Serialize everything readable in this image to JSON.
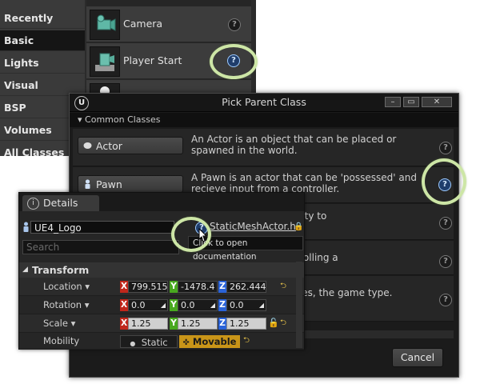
{
  "place_actors": {
    "categories": [
      {
        "label": "Recently Placed",
        "active": false
      },
      {
        "label": "Basic",
        "active": true
      },
      {
        "label": "Lights",
        "active": false
      },
      {
        "label": "Visual",
        "active": false
      },
      {
        "label": "BSP",
        "active": false
      },
      {
        "label": "Volumes",
        "active": false
      },
      {
        "label": "All Classes",
        "active": false
      }
    ],
    "actors": [
      {
        "label": "Camera",
        "help": "?"
      },
      {
        "label": "Player Start",
        "help": "?"
      }
    ]
  },
  "dialog": {
    "title": "Pick Parent Class",
    "logo": "U",
    "window_buttons": [
      "minimize",
      "maximize",
      "close"
    ],
    "window_glyphs": {
      "minimize": "–",
      "maximize": "▭",
      "close": "✕"
    },
    "section_header": "Common Classes",
    "section_arrow": "▾",
    "classes": [
      {
        "name": "Actor",
        "icon": "actor-icon",
        "description": "An Actor is an object that can be placed or spawned in the world.",
        "help": "?"
      },
      {
        "name": "Pawn",
        "icon": "pawn-icon",
        "description": "A Pawn is an actor that can be 'possessed' and recieve input from a controller.",
        "help": "?"
      },
      {
        "name": "",
        "icon": "",
        "description": "n that includes the ability to",
        "help": "?"
      },
      {
        "name": "",
        "icon": "",
        "description": "or responsible for controlling a",
        "help": "?"
      },
      {
        "name": "",
        "icon": "",
        "description": "he being played, its rules, the game type.",
        "help": "?"
      }
    ],
    "cancel_label": "Cancel"
  },
  "details": {
    "tab_label": "Details",
    "tab_icon": "i",
    "actor_name": "UE4_Logo",
    "actor_class_link": "StaticMeshActor.h",
    "search_placeholder": "Search",
    "transform_header": "Transform",
    "transform_arrow": "◢",
    "help_glyph": "?",
    "tooltip": "Click to open documentation",
    "reset_glyph": "⮌",
    "location": {
      "label": "Location",
      "x": "799.515",
      "y": "-1478.4",
      "z": "262.444"
    },
    "rotation": {
      "label": "Rotation",
      "x": "0.0",
      "y": "0.0",
      "z": "0.0"
    },
    "scale": {
      "label": "Scale",
      "x": "1.25",
      "y": "1.25",
      "z": "1.25"
    },
    "mobility": {
      "label": "Mobility",
      "options": [
        "Static",
        "Movable"
      ],
      "selected": "Movable"
    },
    "axis_labels": {
      "x": "X",
      "y": "Y",
      "z": "Z"
    },
    "dropdown_arrow": "▾",
    "rotation_knob": "◢"
  },
  "colors": {
    "highlight_ring": "#cde6a6",
    "axis_x": "#c0271b",
    "axis_y": "#48a81f",
    "axis_z": "#2a63d8",
    "movable_active": "#c99518"
  }
}
